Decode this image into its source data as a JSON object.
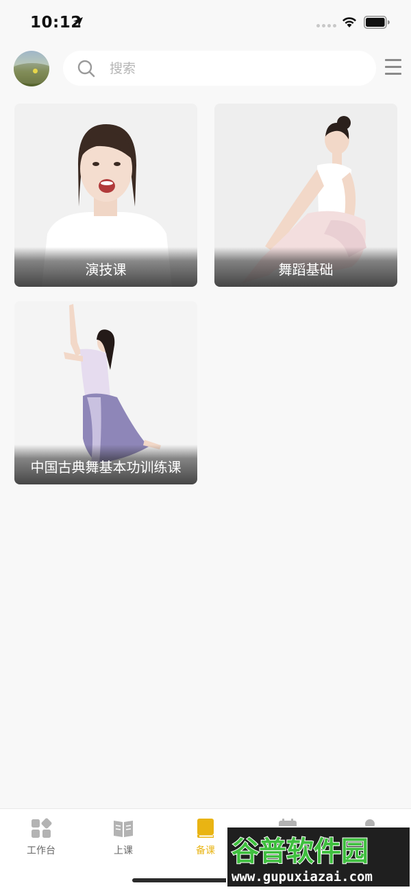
{
  "status_bar": {
    "time": "10:12",
    "icons": [
      "location-arrow-icon",
      "signal-dots-icon",
      "wifi-icon",
      "battery-icon"
    ]
  },
  "header": {
    "search": {
      "placeholder": "搜索"
    },
    "icons": [
      "avatar",
      "search-icon",
      "menu-icon"
    ]
  },
  "courses": [
    {
      "title": "演技课"
    },
    {
      "title": "舞蹈基础"
    },
    {
      "title": "中国古典舞基本功训练课"
    }
  ],
  "tab_bar": {
    "active_index": 2,
    "active_color": "#e9b413",
    "inactive_color": "#b3b3b3",
    "tabs": [
      {
        "label": "工作台",
        "icon": "workbench-icon"
      },
      {
        "label": "上课",
        "icon": "open-book-icon"
      },
      {
        "label": "备课",
        "icon": "lesson-book-icon"
      },
      {
        "label": "",
        "icon": "calendar-icon"
      },
      {
        "label": "",
        "icon": "profile-icon"
      }
    ]
  },
  "watermark": {
    "line1": "谷普软件园",
    "line2": "www.gupuxiazai.com"
  }
}
